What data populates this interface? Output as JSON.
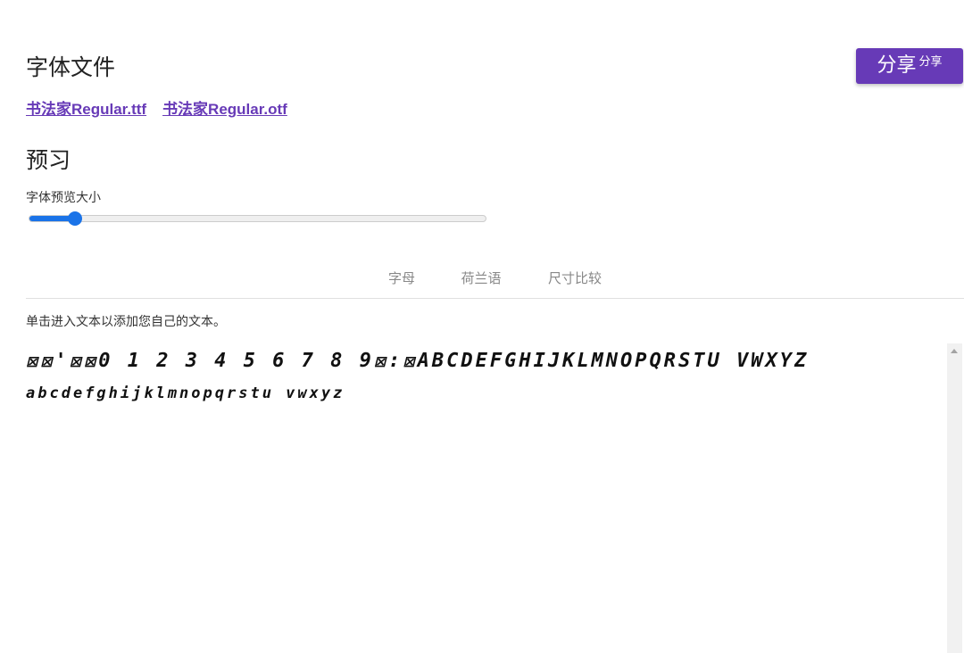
{
  "font_files": {
    "heading": "字体文件",
    "links": [
      "书法家Regular.ttf",
      "书法家Regular.otf"
    ]
  },
  "share": {
    "label_big": "分享",
    "label_small": "分享",
    "color": "#673ab7"
  },
  "preview": {
    "heading": "预习",
    "size_label": "字体预览大小",
    "slider_value": 0.1,
    "tabs": [
      "字母",
      "荷兰语",
      "尺寸比较"
    ],
    "active_tab": 0,
    "hint": "单击进入文本以添加您自己的文本。",
    "sample_line1": "☒☒'☒☒0 1 2 3 4 5 6 7 8 9☒:☒ABCDEFGHIJKLMNOPQRSTU VWXYZ",
    "sample_line2": "abcdefghijklmnopqrstu vwxyz"
  },
  "colors": {
    "accent": "#673ab7",
    "slider": "#1a73e8"
  },
  "icons": {
    "scroll_up": "triangle-up-icon"
  }
}
